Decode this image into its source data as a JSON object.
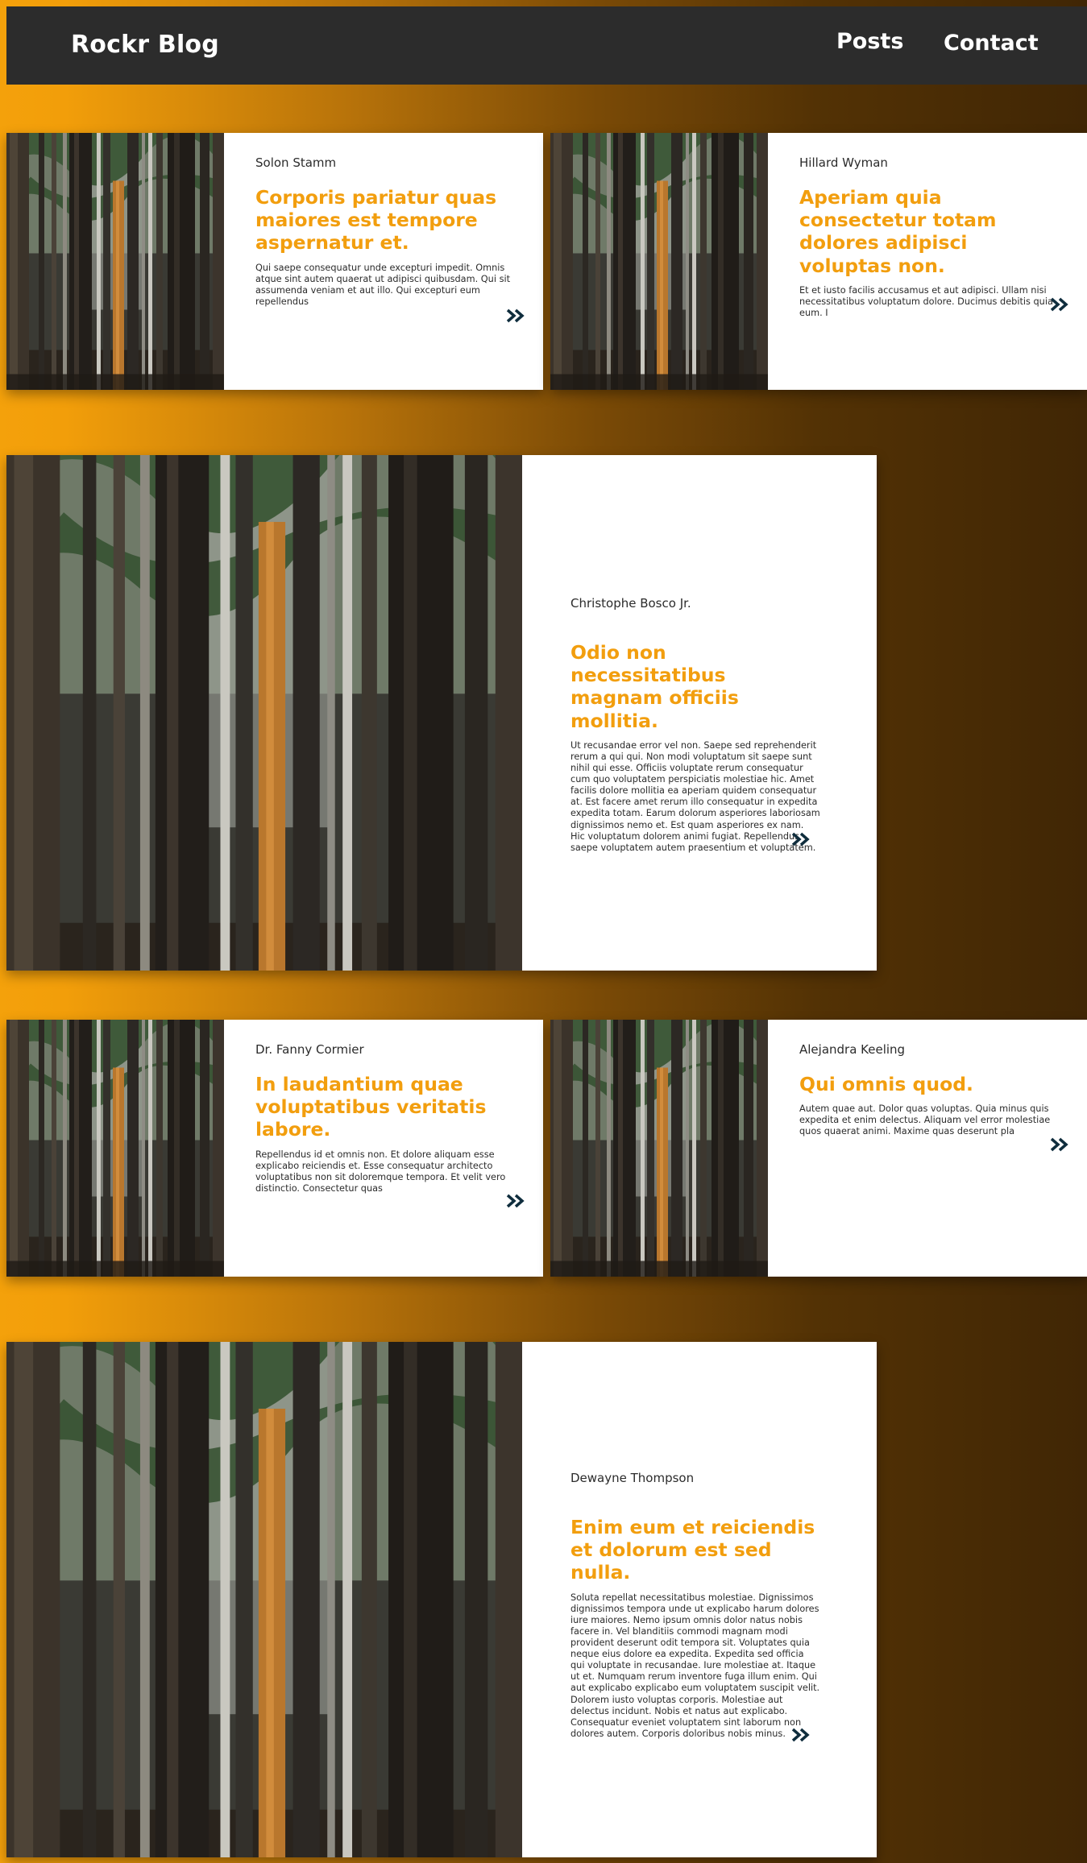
{
  "nav": {
    "brand": "Rockr Blog",
    "links": [
      "Posts",
      "Contact"
    ]
  },
  "colors": {
    "accent": "#f29e0e",
    "nav_bg": "#2c2c2c",
    "arrow": "#0f2d3d"
  },
  "icons": {
    "read_more": "double-chevron-right-icon"
  },
  "posts": [
    {
      "author": "Solon Stamm",
      "title": "Corporis pariatur quas maiores est tempore aspernatur et.",
      "excerpt": "Qui saepe consequatur unde excepturi impedit. Omnis atque sint autem quaerat ut adipisci quibusdam. Qui sit assumenda veniam et aut illo. Qui excepturi eum repellendus"
    },
    {
      "author": "Hillard Wyman",
      "title": "Aperiam quia consectetur totam dolores adipisci voluptas non.",
      "excerpt": "Et et iusto facilis accusamus et aut adipisci. Ullam nisi necessitatibus voluptatum dolore. Ducimus debitis quia eum. I"
    },
    {
      "author": "Christophe Bosco Jr.",
      "title": "Odio non necessitatibus magnam officiis mollitia.",
      "excerpt": "Ut recusandae error vel non. Saepe sed reprehenderit rerum a qui qui. Non modi voluptatum sit saepe sunt nihil qui esse. Officiis voluptate rerum consequatur cum quo voluptatem perspiciatis molestiae hic. Amet facilis dolore mollitia ea aperiam quidem consequatur at. Est facere amet rerum illo consequatur in expedita expedita totam. Earum dolorum asperiores laboriosam dignissimos nemo et. Est quam asperiores ex nam. Hic voluptatum dolorem animi fugiat. Repellendus saepe voluptatem autem praesentium et voluptatem."
    },
    {
      "author": "Dr. Fanny Cormier",
      "title": "In laudantium quae voluptatibus veritatis labore.",
      "excerpt": "Repellendus id et omnis non. Et dolore aliquam esse explicabo reiciendis et. Esse consequatur architecto voluptatibus non sit doloremque tempora. Et velit vero distinctio. Consectetur quas"
    },
    {
      "author": "Alejandra Keeling",
      "title": "Qui omnis quod.",
      "excerpt": "Autem quae aut. Dolor quas voluptas. Quia minus quis expedita et enim delectus. Aliquam vel error molestiae quos quaerat animi. Maxime quas deserunt pla"
    },
    {
      "author": "Dewayne Thompson",
      "title": "Enim eum et reiciendis et dolorum est sed nulla.",
      "excerpt": "Soluta repellat necessitatibus molestiae. Dignissimos dignissimos tempora unde ut explicabo harum dolores iure maiores. Nemo ipsum omnis dolor natus nobis facere in. Vel blanditiis commodi magnam modi provident deserunt odit tempora sit. Voluptates quia neque eius dolore ea expedita. Expedita sed officia qui voluptate in recusandae. Iure molestiae at. Itaque ut et. Numquam rerum inventore fuga illum enim. Qui aut explicabo explicabo eum voluptatem suscipit velit. Dolorem iusto voluptas corporis. Molestiae aut delectus incidunt. Nobis et natus aut explicabo. Consequatur eveniet voluptatem sint laborum non dolores autem. Corporis doloribus nobis minus."
    }
  ]
}
